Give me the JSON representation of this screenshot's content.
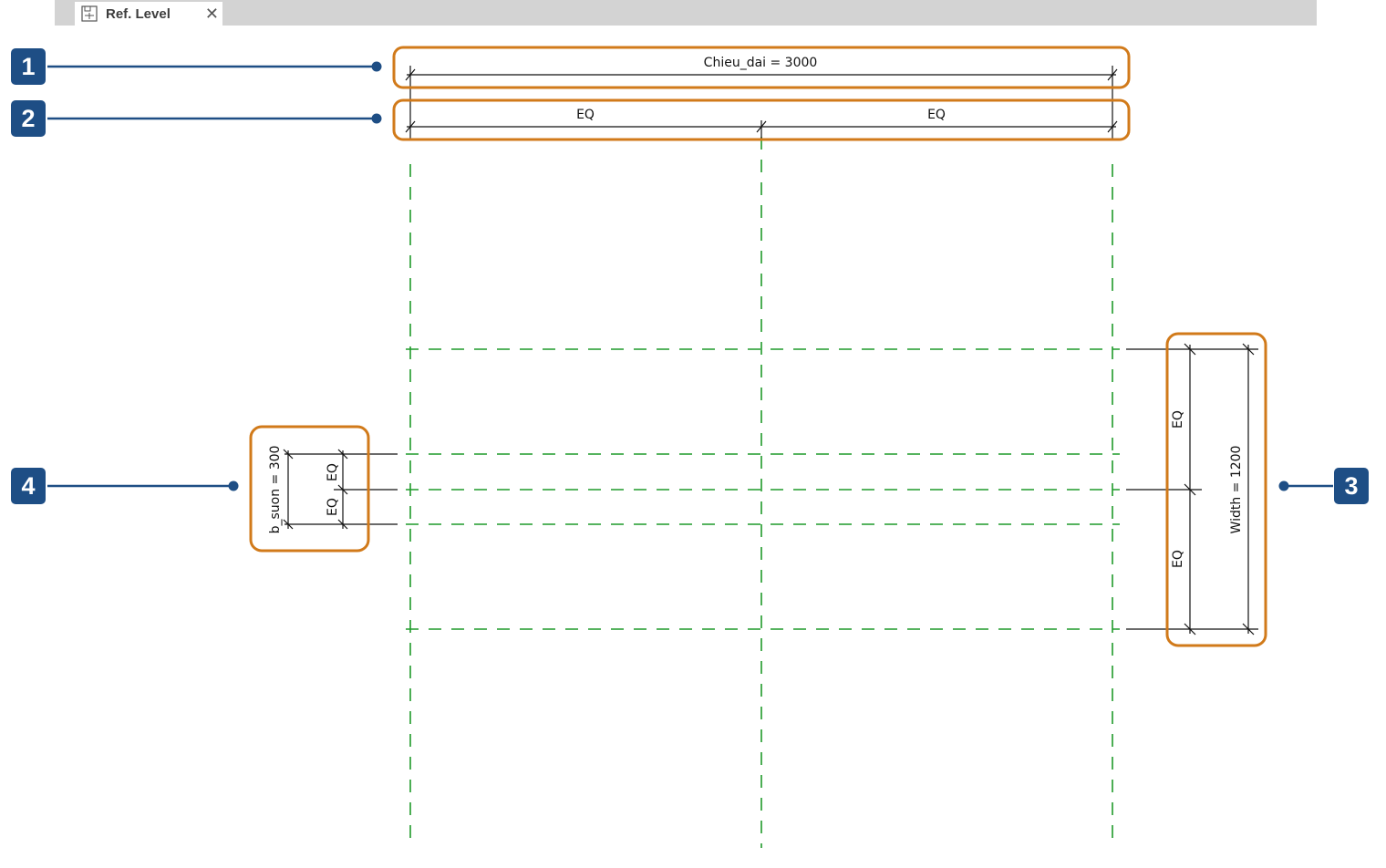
{
  "tab": {
    "title": "Ref. Level",
    "icon": "view-sheet-icon",
    "close_label": "✕"
  },
  "dimensions": {
    "overall_length": "Chieu_dai = 3000",
    "eq_left": "EQ",
    "eq_right": "EQ",
    "width": "Width = 1200",
    "width_eq_top": "EQ",
    "width_eq_bottom": "EQ",
    "rib": "b_suon = 300",
    "rib_eq_top": "EQ",
    "rib_eq_bottom": "EQ"
  },
  "callouts": {
    "c1": "1",
    "c2": "2",
    "c3": "3",
    "c4": "4"
  },
  "colors": {
    "callout_badge": "#1e4e85",
    "highlight": "#d17a1a",
    "reference_plane": "#1f9a2a",
    "dimension_line": "#111111"
  }
}
